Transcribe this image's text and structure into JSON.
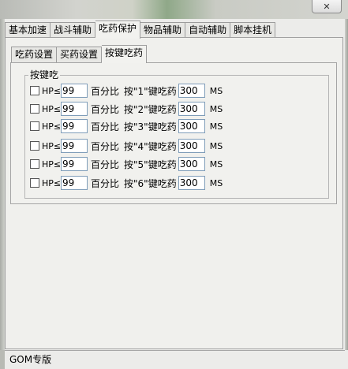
{
  "window": {
    "close_glyph": "✕"
  },
  "tabs": [
    "基本加速",
    "战斗辅助",
    "吃药保护",
    "物品辅助",
    "自动辅助",
    "脚本挂机"
  ],
  "subtabs": [
    "吃药设置",
    "买药设置",
    "按键吃药"
  ],
  "group": {
    "title": "按键吃"
  },
  "rows": [
    {
      "hp_label": "HP≤",
      "percent": "99",
      "pct_text": "百分比",
      "key_text": "按\"1\"键吃药",
      "ms_value": "300",
      "ms_label": "MS"
    },
    {
      "hp_label": "HP≤",
      "percent": "99",
      "pct_text": "百分比",
      "key_text": "按\"2\"键吃药",
      "ms_value": "300",
      "ms_label": "MS"
    },
    {
      "hp_label": "HP≤",
      "percent": "99",
      "pct_text": "百分比",
      "key_text": "按\"3\"键吃药",
      "ms_value": "300",
      "ms_label": "MS"
    },
    {
      "hp_label": "HP≤",
      "percent": "99",
      "pct_text": "百分比",
      "key_text": "按\"4\"键吃药",
      "ms_value": "300",
      "ms_label": "MS"
    },
    {
      "hp_label": "HP≤",
      "percent": "99",
      "pct_text": "百分比",
      "key_text": "按\"5\"键吃药",
      "ms_value": "300",
      "ms_label": "MS"
    },
    {
      "hp_label": "HP≤",
      "percent": "99",
      "pct_text": "百分比",
      "key_text": "按\"6\"键吃药",
      "ms_value": "300",
      "ms_label": "MS"
    }
  ],
  "status": {
    "text": "GOM专版"
  }
}
